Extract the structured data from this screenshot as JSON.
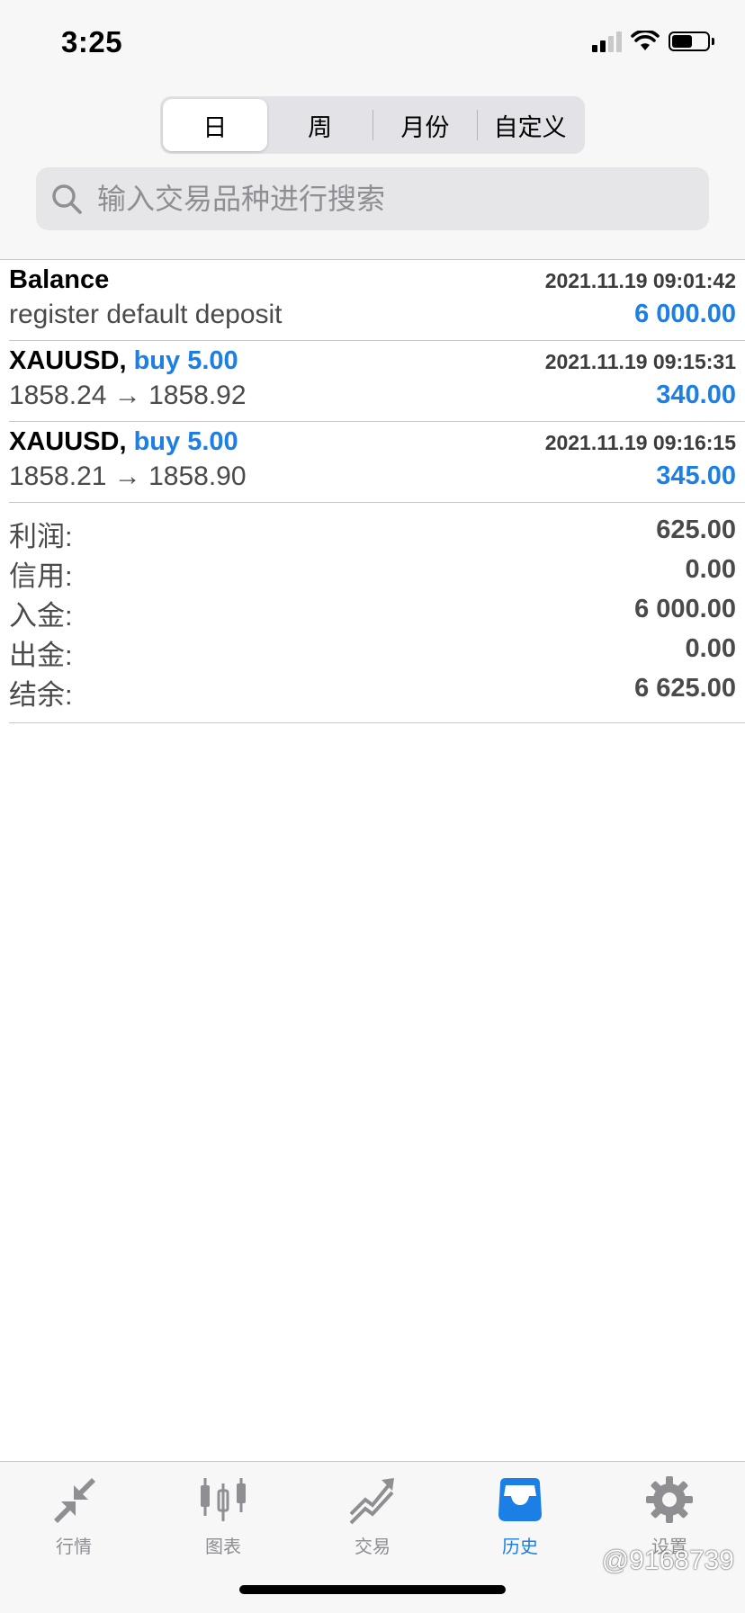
{
  "status_bar": {
    "time": "3:25"
  },
  "segmented": {
    "items": [
      {
        "label": "日"
      },
      {
        "label": "周"
      },
      {
        "label": "月份"
      },
      {
        "label": "自定义"
      }
    ],
    "selected": "日"
  },
  "search": {
    "placeholder": "输入交易品种进行搜索"
  },
  "deals": [
    {
      "title": "Balance",
      "buy": "",
      "time": "2021.11.19 09:01:42",
      "subtitle": "register default deposit",
      "amount": "6 000.00"
    },
    {
      "title": "XAUUSD,",
      "buy": "buy 5.00",
      "time": "2021.11.19 09:15:31",
      "subtitle": "1858.24 → 1858.92",
      "amount": "340.00"
    },
    {
      "title": "XAUUSD,",
      "buy": "buy 5.00",
      "time": "2021.11.19 09:16:15",
      "subtitle": "1858.21 → 1858.90",
      "amount": "345.00"
    }
  ],
  "summary": [
    {
      "label": "利润:",
      "value": "625.00"
    },
    {
      "label": "信用:",
      "value": "0.00"
    },
    {
      "label": "入金:",
      "value": "6 000.00"
    },
    {
      "label": "出金:",
      "value": "0.00"
    },
    {
      "label": "结余:",
      "value": "6 625.00"
    }
  ],
  "tabbar": {
    "items": [
      {
        "label": "行情",
        "icon": "quotes-arrows-icon"
      },
      {
        "label": "图表",
        "icon": "candlestick-chart-icon"
      },
      {
        "label": "交易",
        "icon": "trade-trend-icon"
      },
      {
        "label": "历史",
        "icon": "inbox-history-icon"
      },
      {
        "label": "设置",
        "icon": "gear-icon"
      }
    ],
    "active": "历史"
  },
  "watermark": "@9168739",
  "colors": {
    "accent": "#1b7fe6",
    "inactive": "#8e8e93"
  }
}
